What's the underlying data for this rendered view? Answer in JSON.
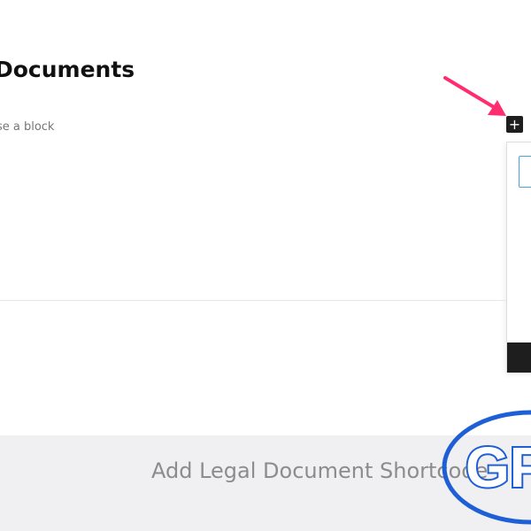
{
  "page": {
    "title": "Documents",
    "block_placeholder": "ose a block"
  },
  "inserter": {
    "add_block_glyph": "+",
    "icon": "plus-icon"
  },
  "shortcode": {
    "label": "Add Legal Document Shortcode"
  },
  "annotation": {
    "arrow_color": "#ff2d6f",
    "icon": "arrow-icon"
  },
  "watermark": {
    "text": "GP",
    "color": "#1f5fd6"
  }
}
